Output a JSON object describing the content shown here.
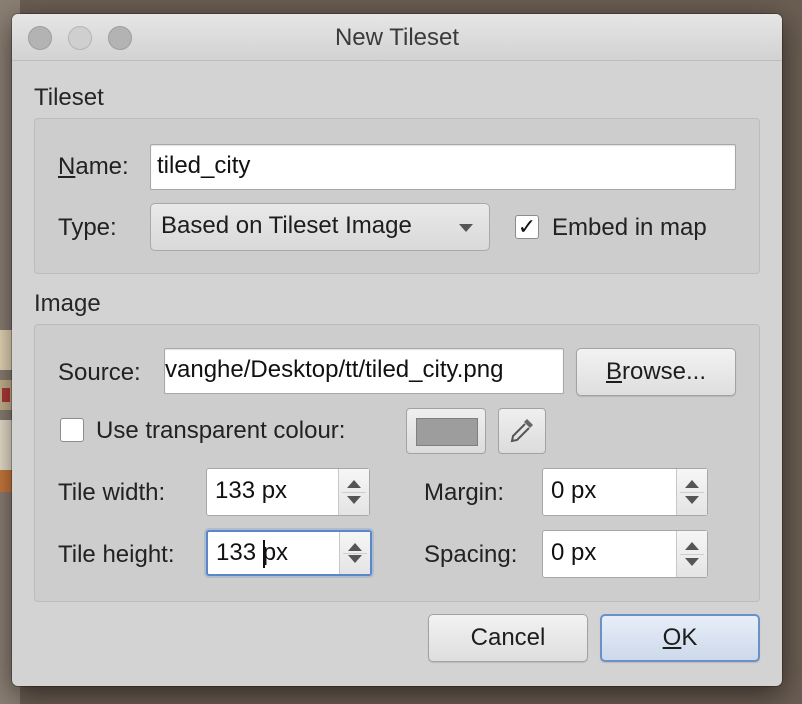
{
  "window": {
    "title": "New Tileset"
  },
  "tileset_section": {
    "heading": "Tileset",
    "name_label_prefix": "",
    "name_label_mnemonic": "N",
    "name_label_rest": "ame:",
    "name_value": "tiled_city",
    "type_label": "Type:",
    "type_value": "Based on Tileset Image",
    "embed_checked_glyph": "✓",
    "embed_label": "Embed in map"
  },
  "image_section": {
    "heading": "Image",
    "source_label": "Source:",
    "source_value": "vanghe/Desktop/tt/tiled_city.png",
    "browse_mnemonic": "B",
    "browse_rest": "rowse...",
    "transparent_label": "Use transparent colour:",
    "transparent_swatch_color": "#9d9d9d",
    "tile_width_label": "Tile width:",
    "tile_width_value": "133 px",
    "tile_height_label": "Tile height:",
    "tile_height_value": "133 px",
    "margin_label": "Margin:",
    "margin_value": "0 px",
    "spacing_label": "Spacing:",
    "spacing_value": "0 px"
  },
  "buttons": {
    "cancel": "Cancel",
    "ok_mnemonic": "O",
    "ok_rest": "K"
  },
  "icons": {
    "traffic": [
      "close-icon",
      "minimize-icon",
      "maximize-icon"
    ],
    "type_dropdown": "chevron-down-icon",
    "picker": "eyedropper-icon"
  }
}
